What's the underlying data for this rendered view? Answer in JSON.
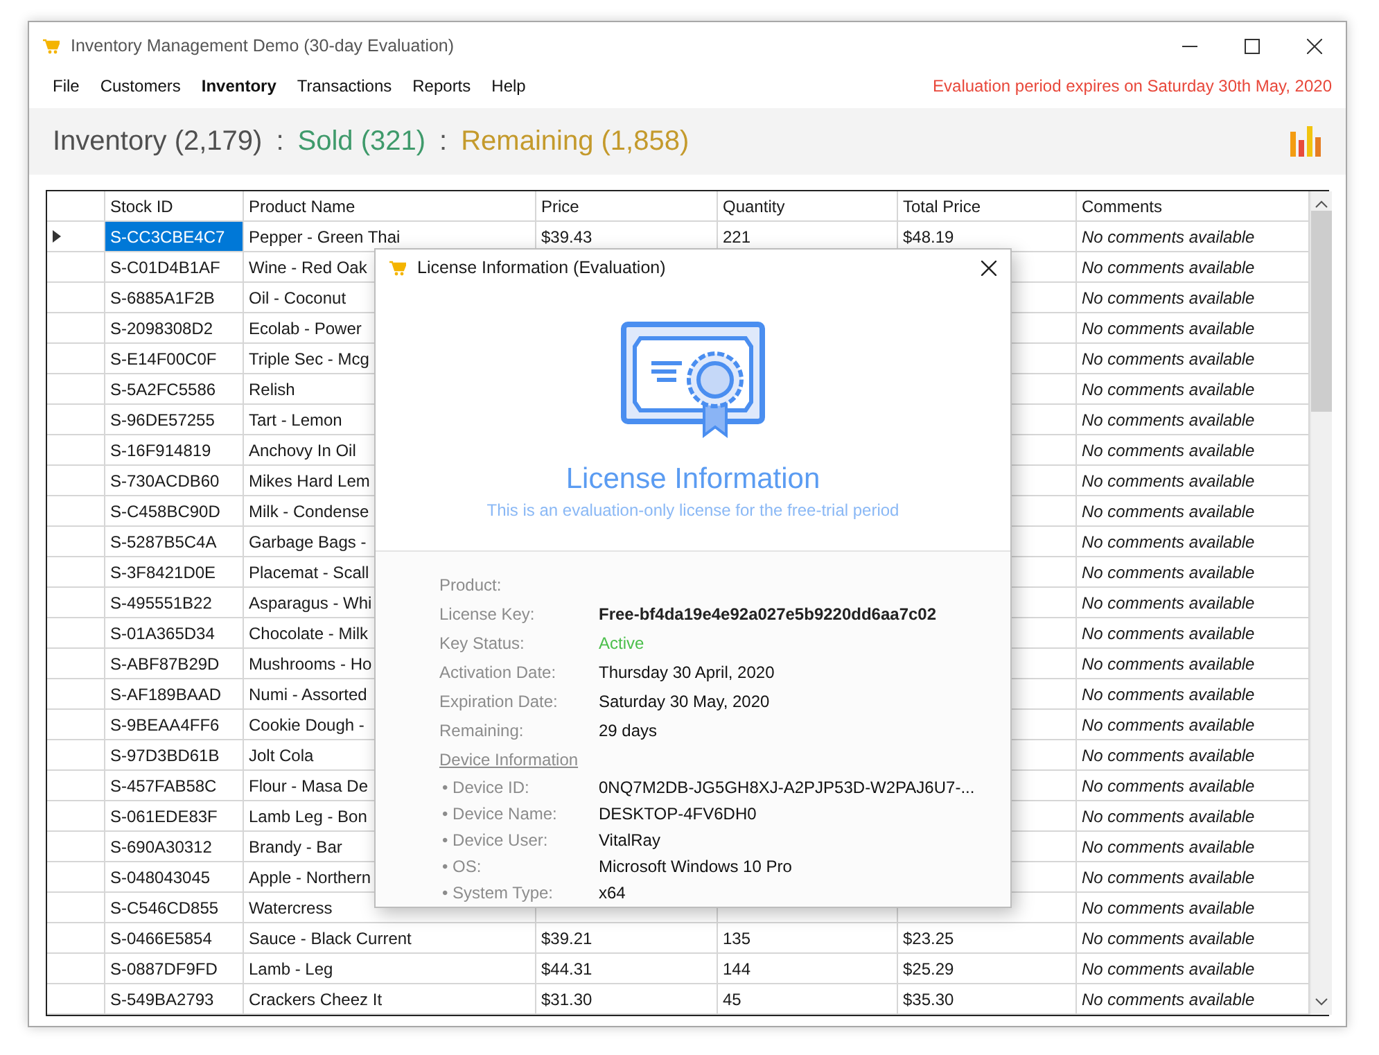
{
  "window": {
    "title": "Inventory Management Demo (30-day Evaluation)"
  },
  "menu": [
    {
      "label": "File",
      "selected": false
    },
    {
      "label": "Customers",
      "selected": false
    },
    {
      "label": "Inventory",
      "selected": true
    },
    {
      "label": "Transactions",
      "selected": false
    },
    {
      "label": "Reports",
      "selected": false
    },
    {
      "label": "Help",
      "selected": false
    }
  ],
  "notice": "Evaluation period expires on Saturday 30th May, 2020",
  "summary": [
    {
      "kind": "count",
      "text": "Inventory (2,179)",
      "color": "#505050"
    },
    {
      "kind": "separator",
      "text": ":"
    },
    {
      "kind": "count",
      "text": "Sold (321)",
      "color": "#3f9a6b"
    },
    {
      "kind": "separator",
      "text": ":"
    },
    {
      "kind": "count",
      "text": "Remaining (1,858)",
      "color": "#c49a2c"
    }
  ],
  "table": {
    "columns": [
      "Stock ID",
      "Product Name",
      "Price",
      "Quantity",
      "Total Price",
      "Comments"
    ],
    "rows": [
      {
        "selected": true,
        "stock_id": "S-CC3CBE4C7",
        "product_name": "Pepper - Green Thai",
        "price": "$39.43",
        "quantity": "221",
        "total_price": "$48.19",
        "comments": "No comments available"
      },
      {
        "selected": false,
        "stock_id": "S-C01D4B1AF",
        "product_name": "Wine - Red Oak",
        "comments": "No comments available"
      },
      {
        "selected": false,
        "stock_id": "S-6885A1F2B",
        "product_name": "Oil - Coconut",
        "comments": "No comments available"
      },
      {
        "selected": false,
        "stock_id": "S-2098308D2",
        "product_name": "Ecolab - Power",
        "comments": "No comments available"
      },
      {
        "selected": false,
        "stock_id": "S-E14F00C0F",
        "product_name": "Triple Sec - Mcg",
        "comments": "No comments available"
      },
      {
        "selected": false,
        "stock_id": "S-5A2FC5586",
        "product_name": "Relish",
        "comments": "No comments available"
      },
      {
        "selected": false,
        "stock_id": "S-96DE57255",
        "product_name": "Tart - Lemon",
        "comments": "No comments available"
      },
      {
        "selected": false,
        "stock_id": "S-16F914819",
        "product_name": "Anchovy In Oil",
        "comments": "No comments available"
      },
      {
        "selected": false,
        "stock_id": "S-730ACDB60",
        "product_name": "Mikes Hard Lem",
        "comments": "No comments available"
      },
      {
        "selected": false,
        "stock_id": "S-C458BC90D",
        "product_name": "Milk - Condense",
        "comments": "No comments available"
      },
      {
        "selected": false,
        "stock_id": "S-5287B5C4A",
        "product_name": "Garbage Bags -",
        "comments": "No comments available"
      },
      {
        "selected": false,
        "stock_id": "S-3F8421D0E",
        "product_name": "Placemat - Scall",
        "comments": "No comments available"
      },
      {
        "selected": false,
        "stock_id": "S-495551B22",
        "product_name": "Asparagus - Whi",
        "comments": "No comments available"
      },
      {
        "selected": false,
        "stock_id": "S-01A365D34",
        "product_name": "Chocolate - Milk",
        "comments": "No comments available"
      },
      {
        "selected": false,
        "stock_id": "S-ABF87B29D",
        "product_name": "Mushrooms - Ho",
        "comments": "No comments available"
      },
      {
        "selected": false,
        "stock_id": "S-AF189BAAD",
        "product_name": "Numi - Assorted",
        "comments": "No comments available"
      },
      {
        "selected": false,
        "stock_id": "S-9BEAA4FF6",
        "product_name": "Cookie Dough -",
        "comments": "No comments available"
      },
      {
        "selected": false,
        "stock_id": "S-97D3BD61B",
        "product_name": "Jolt Cola",
        "comments": "No comments available"
      },
      {
        "selected": false,
        "stock_id": "S-457FAB58C",
        "product_name": "Flour - Masa De",
        "comments": "No comments available"
      },
      {
        "selected": false,
        "stock_id": "S-061EDE83F",
        "product_name": "Lamb Leg - Bon",
        "comments": "No comments available"
      },
      {
        "selected": false,
        "stock_id": "S-690A30312",
        "product_name": "Brandy - Bar",
        "comments": "No comments available"
      },
      {
        "selected": false,
        "stock_id": "S-048043045",
        "product_name": "Apple - Northern",
        "comments": "No comments available"
      },
      {
        "selected": false,
        "stock_id": "S-C546CD855",
        "product_name": "Watercress",
        "comments": "No comments available"
      },
      {
        "selected": false,
        "stock_id": "S-0466E5854",
        "product_name": "Sauce - Black Current",
        "price": "$39.21",
        "quantity": "135",
        "total_price": "$23.25",
        "comments": "No comments available"
      },
      {
        "selected": false,
        "stock_id": "S-0887DF9FD",
        "product_name": "Lamb - Leg",
        "price": "$44.31",
        "quantity": "144",
        "total_price": "$25.29",
        "comments": "No comments available"
      },
      {
        "selected": false,
        "stock_id": "S-549BA2793",
        "product_name": "Crackers Cheez It",
        "price": "$31.30",
        "quantity": "45",
        "total_price": "$35.30",
        "comments": "No comments available"
      }
    ]
  },
  "dialog": {
    "title": "License Information (Evaluation)",
    "heading": "License Information",
    "subtitle": "This is an evaluation-only license for the free-trial period",
    "fields": [
      {
        "kind": "field",
        "label": "Product:"
      },
      {
        "kind": "key",
        "label": "License Key:",
        "value": "Free-bf4da19e4e92a027e5b9220dd6aa7c02"
      },
      {
        "kind": "status",
        "label": "Key Status:",
        "value": "Active"
      },
      {
        "kind": "field",
        "label": "Activation Date:",
        "value": "Thursday 30 April, 2020"
      },
      {
        "kind": "field",
        "label": "Expiration Date:",
        "value": "Saturday 30 May, 2020"
      },
      {
        "kind": "field",
        "label": "Remaining:",
        "value": "29 days"
      },
      {
        "kind": "section",
        "label": "Device Information"
      },
      {
        "kind": "device",
        "label": "• Device ID:",
        "value": "0NQ7M2DB-JG5GH8XJ-A2PJP53D-W2PAJ6U7-..."
      },
      {
        "kind": "device",
        "label": "• Device Name:",
        "value": "DESKTOP-4FV6DH0"
      },
      {
        "kind": "device",
        "label": "• Device User:",
        "value": "VitalRay"
      },
      {
        "kind": "device",
        "label": "• OS:",
        "value": "Microsoft Windows 10 Pro"
      },
      {
        "kind": "device",
        "label": "• System Type:",
        "value": "x64"
      }
    ]
  }
}
